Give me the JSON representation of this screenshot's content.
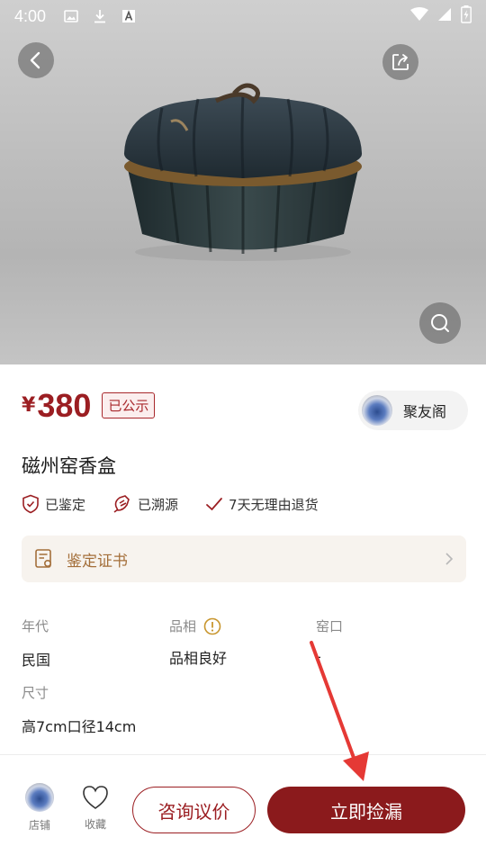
{
  "status_bar": {
    "time": "4:00"
  },
  "product": {
    "currency": "¥",
    "price": "380",
    "public_badge": "已公示",
    "title": "磁州窑香盒"
  },
  "shop": {
    "name": "聚友阁"
  },
  "tags": [
    {
      "label": "已鉴定",
      "icon": "shield-check-icon"
    },
    {
      "label": "已溯源",
      "icon": "trace-source-icon"
    },
    {
      "label": "7天无理由退货",
      "icon": "checkmark-icon"
    }
  ],
  "certificate": {
    "label": "鉴定证书"
  },
  "info": [
    {
      "key": "年代",
      "value": "民国"
    },
    {
      "key": "品相",
      "value": "品相良好",
      "has_info_icon": true
    },
    {
      "key": "窑口",
      "value": "-"
    },
    {
      "key": "尺寸",
      "value": "高7cm口径14cm"
    }
  ],
  "bottom_bar": {
    "store_label": "店铺",
    "fav_label": "收藏",
    "consult_label": "咨询议价",
    "buy_label": "立即捡漏"
  },
  "colors": {
    "brand_red": "#9b1e22",
    "buy_button": "#8b1a1c",
    "cert_text": "#a46f3a",
    "cert_bg": "#f7f3ee",
    "annotation_arrow": "#e53935"
  }
}
